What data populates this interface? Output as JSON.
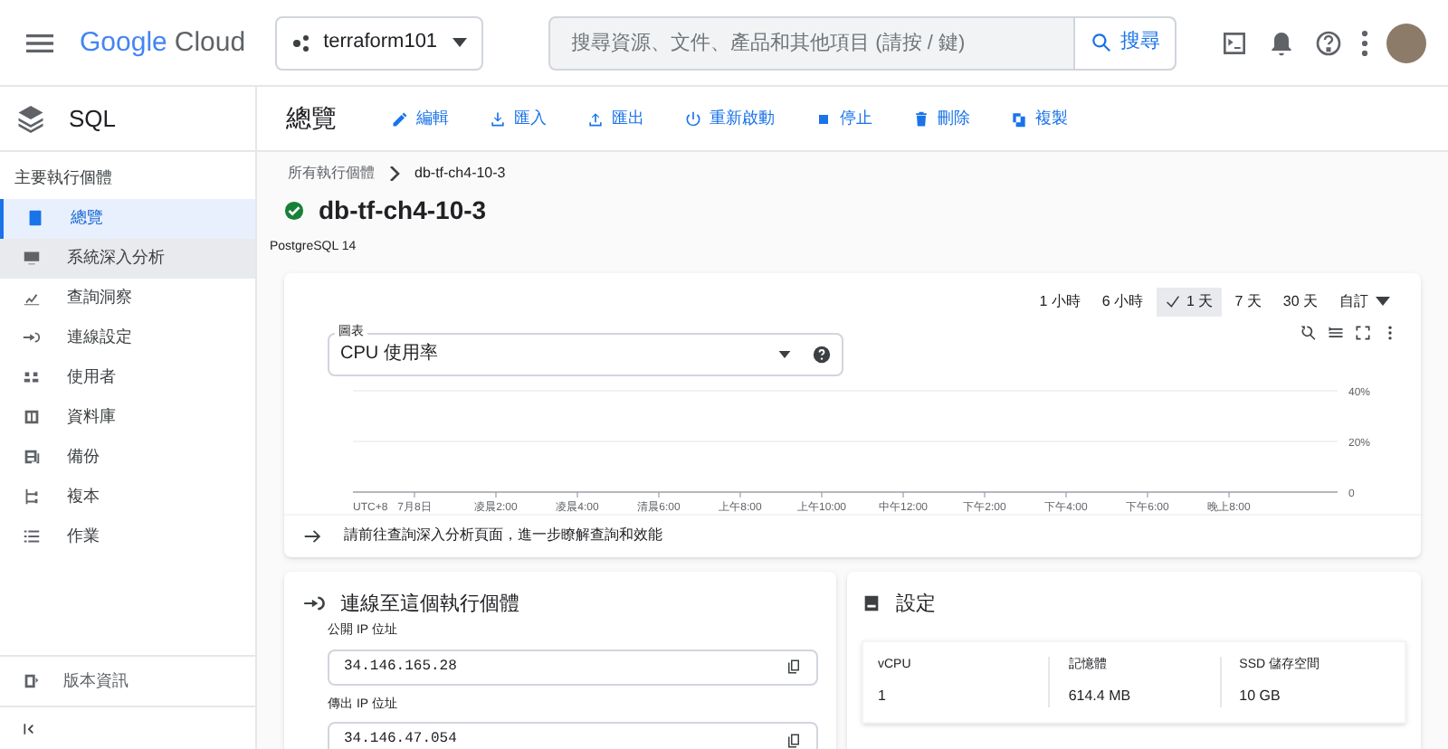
{
  "top_bar": {
    "logo": {
      "google": "Google",
      "cloud": "Cloud"
    },
    "project": "terraform101",
    "search": {
      "placeholder": "搜尋資源、文件、產品和其他項目 (請按 / 鍵)",
      "button": "搜尋"
    }
  },
  "sidebar": {
    "product": "SQL",
    "section": "主要執行個體",
    "items": [
      {
        "label": "總覽",
        "selected": true
      },
      {
        "label": "系統深入分析",
        "selected": false
      },
      {
        "label": "查詢洞察",
        "selected": false
      },
      {
        "label": "連線設定",
        "selected": false
      },
      {
        "label": "使用者",
        "selected": false
      },
      {
        "label": "資料庫",
        "selected": false
      },
      {
        "label": "備份",
        "selected": false
      },
      {
        "label": "複本",
        "selected": false
      },
      {
        "label": "作業",
        "selected": false
      }
    ],
    "release_notes": "版本資訊"
  },
  "page_header": {
    "title": "總覽",
    "actions": [
      "編輯",
      "匯入",
      "匯出",
      "重新啟動",
      "停止",
      "刪除",
      "複製"
    ]
  },
  "breadcrumb": {
    "parent": "所有執行個體",
    "current": "db-tf-ch4-10-3"
  },
  "instance": {
    "name": "db-tf-ch4-10-3",
    "version": "PostgreSQL 14"
  },
  "time_ranges": [
    {
      "label": "1 小時",
      "selected": false
    },
    {
      "label": "6 小時",
      "selected": false
    },
    {
      "label": "1 天",
      "selected": true
    },
    {
      "label": "7 天",
      "selected": false
    },
    {
      "label": "30 天",
      "selected": false
    },
    {
      "label": "自訂",
      "selected": false
    }
  ],
  "chart_select": {
    "label": "圖表",
    "value": "CPU 使用率"
  },
  "chart": {
    "chart_data": {
      "type": "line",
      "xlabel": "UTC+8",
      "categories": [
        "7月8日",
        "凌晨2:00",
        "凌晨4:00",
        "清晨6:00",
        "上午8:00",
        "上午10:00",
        "中午12:00",
        "下午2:00",
        "下午4:00",
        "下午6:00",
        "晚上8:00"
      ],
      "ylim": [
        0,
        40
      ],
      "yticks": [
        {
          "value": 0,
          "label": "0"
        },
        {
          "value": 20,
          "label": "20%"
        },
        {
          "value": 40,
          "label": "40%"
        }
      ]
    }
  },
  "insights_link": "請前往查詢深入分析頁面，進一步瞭解查詢和效能",
  "connect": {
    "title": "連線至這個執行個體",
    "fields": [
      {
        "label": "公開 IP 位址",
        "value": "34.146.165.28"
      },
      {
        "label": "傳出 IP 位址",
        "value": "34.146.47.054"
      }
    ]
  },
  "settings": {
    "title": "設定",
    "specs": [
      {
        "label": "vCPU",
        "value": "1"
      },
      {
        "label": "記憶體",
        "value": "614.4 MB"
      },
      {
        "label": "SSD 儲存空間",
        "value": "10 GB"
      }
    ]
  }
}
